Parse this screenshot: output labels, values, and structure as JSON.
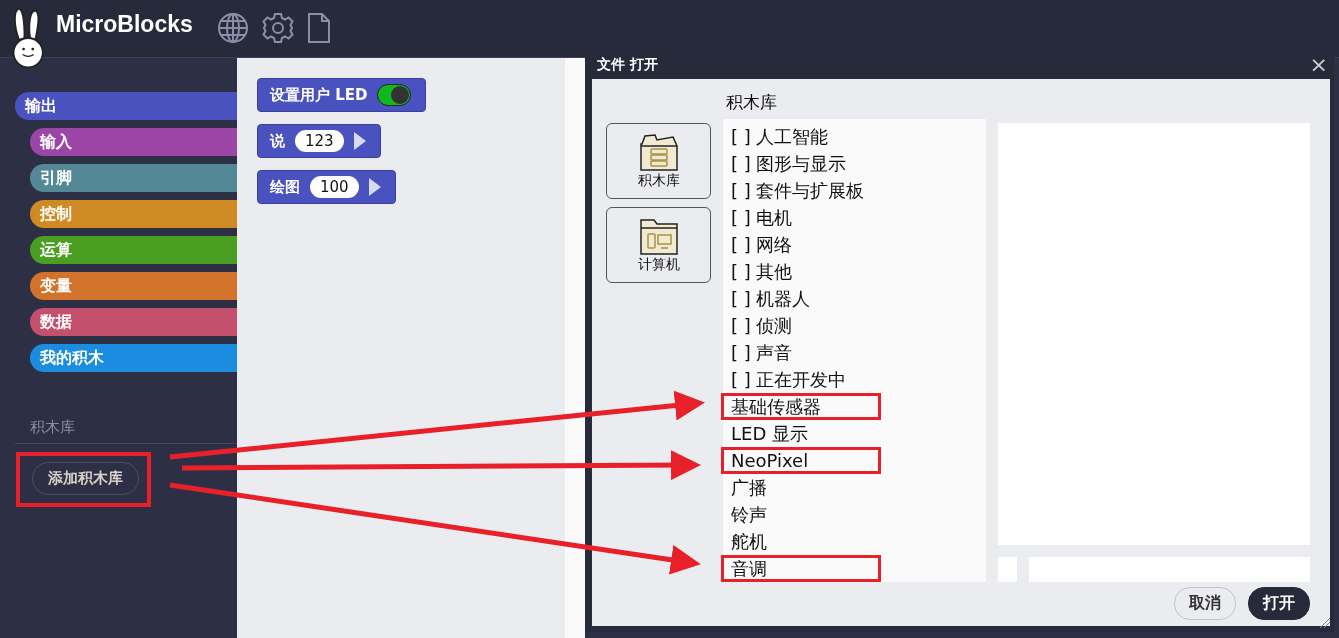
{
  "app": {
    "title": "MicroBlocks"
  },
  "categories": [
    {
      "label": "输出",
      "color": "#4a52c0",
      "selected": true
    },
    {
      "label": "输入",
      "color": "#9b45a6",
      "selected": false
    },
    {
      "label": "引脚",
      "color": "#558896",
      "selected": false
    },
    {
      "label": "控制",
      "color": "#d08a24",
      "selected": false
    },
    {
      "label": "运算",
      "color": "#4a9e22",
      "selected": false
    },
    {
      "label": "变量",
      "color": "#d3722b",
      "selected": false
    },
    {
      "label": "数据",
      "color": "#c4506e",
      "selected": false
    },
    {
      "label": "我的积木",
      "color": "#1c8ce0",
      "selected": false
    }
  ],
  "libraries": {
    "heading": "积木库",
    "add_button": {
      "label": "添加积木库",
      "highlighted": true
    }
  },
  "blocks": [
    {
      "kind": "toggle",
      "label": "设置用户 LED",
      "on": true
    },
    {
      "kind": "slot",
      "label": "说",
      "value": "123"
    },
    {
      "kind": "slot",
      "label": "绘图",
      "value": "100"
    }
  ],
  "dialog": {
    "title": "文件 打开",
    "close": "×",
    "folder": "积木库",
    "sources": [
      {
        "label": "积木库",
        "kind": "library"
      },
      {
        "label": "计算机",
        "kind": "computer"
      }
    ],
    "files": [
      {
        "name": "[ ] 人工智能",
        "highlighted": false
      },
      {
        "name": "[ ] 图形与显示",
        "highlighted": false
      },
      {
        "name": "[ ] 套件与扩展板",
        "highlighted": false
      },
      {
        "name": "[ ] 电机",
        "highlighted": false
      },
      {
        "name": "[ ] 网络",
        "highlighted": false
      },
      {
        "name": "[ ] 其他",
        "highlighted": false
      },
      {
        "name": "[ ] 机器人",
        "highlighted": false
      },
      {
        "name": "[ ] 侦测",
        "highlighted": false
      },
      {
        "name": "[ ] 声音",
        "highlighted": false
      },
      {
        "name": "[ ] 正在开发中",
        "highlighted": false
      },
      {
        "name": "基础传感器",
        "highlighted": true
      },
      {
        "name": "LED 显示",
        "highlighted": false
      },
      {
        "name": "NeoPixel",
        "highlighted": true
      },
      {
        "name": "广播",
        "highlighted": false
      },
      {
        "name": "铃声",
        "highlighted": false
      },
      {
        "name": "舵机",
        "highlighted": false
      },
      {
        "name": "音调",
        "highlighted": true
      }
    ],
    "buttons": [
      {
        "label": "取消",
        "kind": "secondary"
      },
      {
        "label": "打开",
        "kind": "primary"
      }
    ]
  }
}
